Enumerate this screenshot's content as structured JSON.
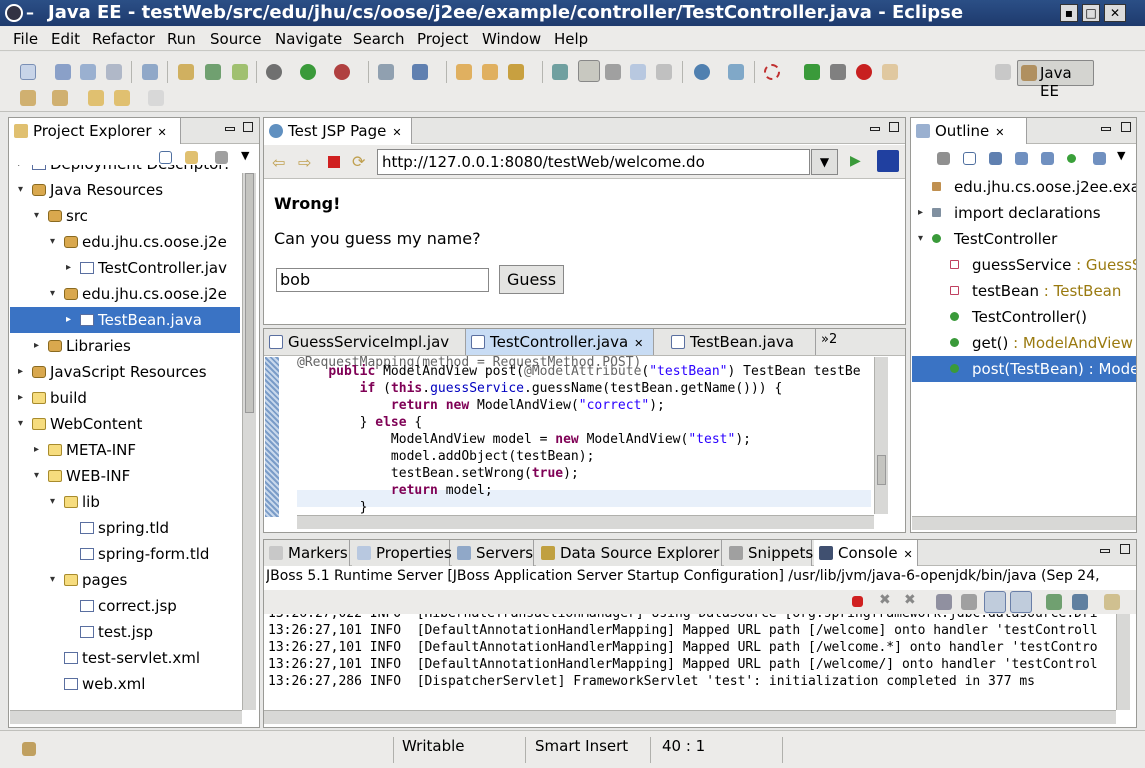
{
  "window": {
    "title": "Java EE - testWeb/src/edu/jhu/cs/oose/j2ee/example/controller/TestController.java - Eclipse",
    "dash": "–"
  },
  "menu": [
    "File",
    "Edit",
    "Refactor",
    "Run",
    "Source",
    "Navigate",
    "Search",
    "Project",
    "Window",
    "Help"
  ],
  "perspective": {
    "label": "Java EE"
  },
  "project_explorer": {
    "tab_label": "Project Explorer",
    "rows": [
      {
        "label": "Deployment Descriptor:",
        "indent": 0,
        "arrow": "▸",
        "icon": "dd"
      },
      {
        "label": "Java Resources",
        "indent": 0,
        "arrow": "▾",
        "icon": "jr"
      },
      {
        "label": "src",
        "indent": 1,
        "arrow": "▾",
        "icon": "src"
      },
      {
        "label": "edu.jhu.cs.oose.j2e",
        "indent": 2,
        "arrow": "▾",
        "icon": "pkg"
      },
      {
        "label": "TestController.jav",
        "indent": 3,
        "arrow": "▸",
        "icon": "java"
      },
      {
        "label": "edu.jhu.cs.oose.j2e",
        "indent": 2,
        "arrow": "▾",
        "icon": "pkg"
      },
      {
        "label": "TestBean.java",
        "indent": 3,
        "arrow": "▸",
        "icon": "java",
        "selected": true
      },
      {
        "label": "Libraries",
        "indent": 1,
        "arrow": "▸",
        "icon": "lib"
      },
      {
        "label": "JavaScript Resources",
        "indent": 0,
        "arrow": "▸",
        "icon": "js"
      },
      {
        "label": "build",
        "indent": 0,
        "arrow": "▸",
        "icon": "folder"
      },
      {
        "label": "WebContent",
        "indent": 0,
        "arrow": "▾",
        "icon": "folder"
      },
      {
        "label": "META-INF",
        "indent": 1,
        "arrow": "▸",
        "icon": "folder"
      },
      {
        "label": "WEB-INF",
        "indent": 1,
        "arrow": "▾",
        "icon": "folder"
      },
      {
        "label": "lib",
        "indent": 2,
        "arrow": "▾",
        "icon": "folder"
      },
      {
        "label": "spring.tld",
        "indent": 3,
        "arrow": "",
        "icon": "xml"
      },
      {
        "label": "spring-form.tld",
        "indent": 3,
        "arrow": "",
        "icon": "xml"
      },
      {
        "label": "pages",
        "indent": 2,
        "arrow": "▾",
        "icon": "folder"
      },
      {
        "label": "correct.jsp",
        "indent": 3,
        "arrow": "",
        "icon": "file"
      },
      {
        "label": "test.jsp",
        "indent": 3,
        "arrow": "",
        "icon": "file"
      },
      {
        "label": "test-servlet.xml",
        "indent": 2,
        "arrow": "",
        "icon": "xml"
      },
      {
        "label": "web.xml",
        "indent": 2,
        "arrow": "",
        "icon": "xml"
      }
    ]
  },
  "browser": {
    "tab_label": "Test JSP Page",
    "url": "http://127.0.0.1:8080/testWeb/welcome.do",
    "heading": "Wrong!",
    "question": "Can you guess my name?",
    "input_value": "bob",
    "button_label": "Guess"
  },
  "editor": {
    "tabs": [
      "GuessServiceImpl.jav",
      "TestController.java",
      "TestBean.java"
    ],
    "overflow": "»2"
  },
  "outline": {
    "tab_label": "Outline",
    "rows": [
      {
        "label": "edu.jhu.cs.oose.j2ee.exa",
        "type": "",
        "indent": 0,
        "icon": "pkg"
      },
      {
        "label": "import declarations",
        "type": "",
        "indent": 0,
        "icon": "imp",
        "arrow": "▸"
      },
      {
        "label": "TestController",
        "type": "",
        "indent": 0,
        "icon": "class",
        "arrow": "▾"
      },
      {
        "label": "guessService",
        "type": " : GuessS",
        "indent": 1,
        "icon": "field"
      },
      {
        "label": "testBean",
        "type": " : TestBean",
        "indent": 1,
        "icon": "field"
      },
      {
        "label": "TestController()",
        "type": "",
        "indent": 1,
        "icon": "ctor"
      },
      {
        "label": "get()",
        "type": " : ModelAndView",
        "indent": 1,
        "icon": "method"
      },
      {
        "label": "post(TestBean)",
        "type": " : Mode",
        "indent": 1,
        "icon": "method",
        "selected": true
      }
    ]
  },
  "bottom_tabs": [
    "Markers",
    "Properties",
    "Servers",
    "Data Source Explorer",
    "Snippets",
    "Console"
  ],
  "console": {
    "header": "JBoss 5.1 Runtime Server [JBoss Application Server Startup Configuration] /usr/lib/jvm/java-6-openjdk/bin/java (Sep 24,",
    "lines": [
      "13:26:27,022 INFO  [HibernateTransactionManager] Using DataSource [org.springframework.jdbc.datasource.Dri",
      "13:26:27,101 INFO  [DefaultAnnotationHandlerMapping] Mapped URL path [/welcome] onto handler 'testControll",
      "13:26:27,101 INFO  [DefaultAnnotationHandlerMapping] Mapped URL path [/welcome.*] onto handler 'testContro",
      "13:26:27,101 INFO  [DefaultAnnotationHandlerMapping] Mapped URL path [/welcome/] onto handler 'testControl",
      "13:26:27,286 INFO  [DispatcherServlet] FrameworkServlet 'test': initialization completed in 377 ms"
    ]
  },
  "status": {
    "writable": "Writable",
    "insert_mode": "Smart Insert",
    "position": "40 : 1"
  }
}
